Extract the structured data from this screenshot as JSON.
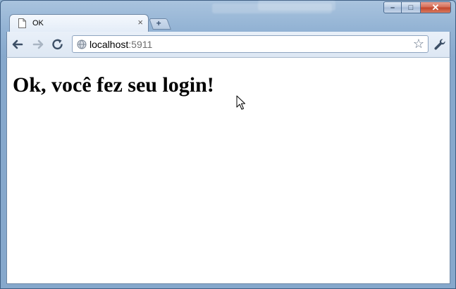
{
  "tab": {
    "title": "OK",
    "close_glyph": "×"
  },
  "new_tab_glyph": "+",
  "window_controls": {
    "minimize": "–",
    "maximize": "□",
    "close": "✕"
  },
  "toolbar": {
    "back_icon": "arrow-left-icon",
    "forward_icon": "arrow-right-icon",
    "reload_icon": "reload-icon",
    "wrench_icon": "wrench-icon",
    "star_glyph": "☆"
  },
  "address": {
    "host": "localhost",
    "port": ":5911"
  },
  "page": {
    "heading": "Ok, você fez seu login!"
  },
  "colors": {
    "frame": "#93b3d4",
    "tab_bg": "#f4f8fd",
    "toolbar_bg": "#e3ecf7"
  }
}
